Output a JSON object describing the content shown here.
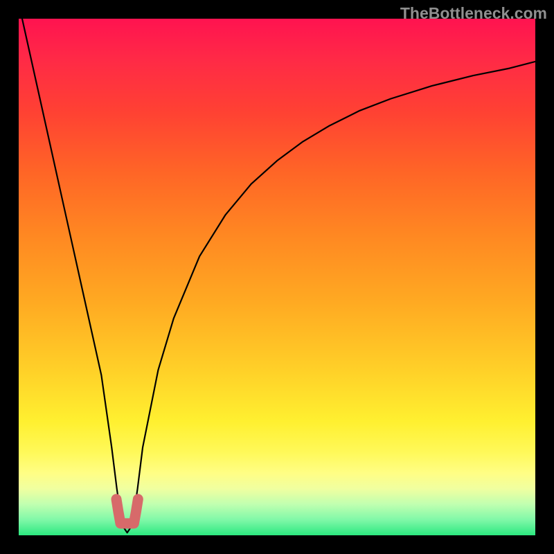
{
  "watermark": "TheBottleneck.com",
  "colors": {
    "black": "#000000",
    "curve": "#000000",
    "marker": "#d76a6a",
    "gradient": [
      "#ff1350",
      "#ff2a46",
      "#ff4133",
      "#ff6626",
      "#ff8822",
      "#ffaa22",
      "#ffd028",
      "#fff030",
      "#fff95a",
      "#fffe85",
      "#f0ffa0",
      "#c0ffb0",
      "#80f8a8",
      "#2ce880"
    ]
  },
  "chart_data": {
    "type": "line",
    "title": "",
    "xlabel": "",
    "ylabel": "",
    "xlim": [
      0,
      100
    ],
    "ylim": [
      0,
      100
    ],
    "notch_center_x": 21,
    "series": [
      {
        "name": "bottleneck-curve",
        "x": [
          0,
          2,
          4,
          6,
          8,
          10,
          12,
          14,
          16,
          18,
          19,
          20,
          21,
          22,
          23,
          24,
          27,
          30,
          35,
          40,
          45,
          50,
          55,
          60,
          66,
          72,
          80,
          88,
          95,
          100
        ],
        "values": [
          103,
          94,
          85,
          76,
          67,
          58,
          49,
          40,
          31,
          17,
          9,
          2,
          0.5,
          2,
          9,
          17,
          32,
          42,
          54,
          62,
          68,
          72.5,
          76.2,
          79.2,
          82.2,
          84.5,
          87,
          89,
          90.4,
          91.7
        ]
      },
      {
        "name": "notch-marker",
        "x": [
          18.9,
          19.3,
          19.7,
          20.7,
          21.0,
          21.3,
          22.3,
          22.7,
          23.1
        ],
        "values": [
          7.0,
          4.5,
          2.3,
          2.3,
          2.3,
          2.3,
          2.3,
          4.5,
          7.0
        ]
      }
    ]
  }
}
